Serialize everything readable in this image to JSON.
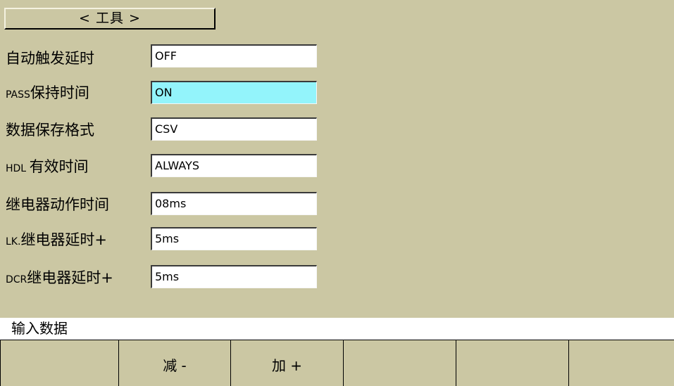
{
  "title": "< 工具 >",
  "rows": [
    {
      "prefix": "",
      "label": "自动触发延时",
      "value": "OFF"
    },
    {
      "prefix": "PASS",
      "label": "保持时间",
      "value": "ON"
    },
    {
      "prefix": "",
      "label": "数据保存格式",
      "value": "CSV"
    },
    {
      "prefix": "HDL ",
      "label": "有效时间",
      "value": "ALWAYS"
    },
    {
      "prefix": "",
      "label": "继电器动作时间",
      "value": "08ms"
    },
    {
      "prefix": "LK.",
      "label": "继电器延时+",
      "value": "5ms"
    },
    {
      "prefix": "DCR",
      "label": "继电器延时+",
      "value": "5ms"
    }
  ],
  "selected_field_color": "#93f4fb",
  "background_color": "#cbc7a3",
  "prompt": "输入数据",
  "softkeys": [
    "",
    "减 -",
    "加 +",
    "",
    "",
    ""
  ]
}
